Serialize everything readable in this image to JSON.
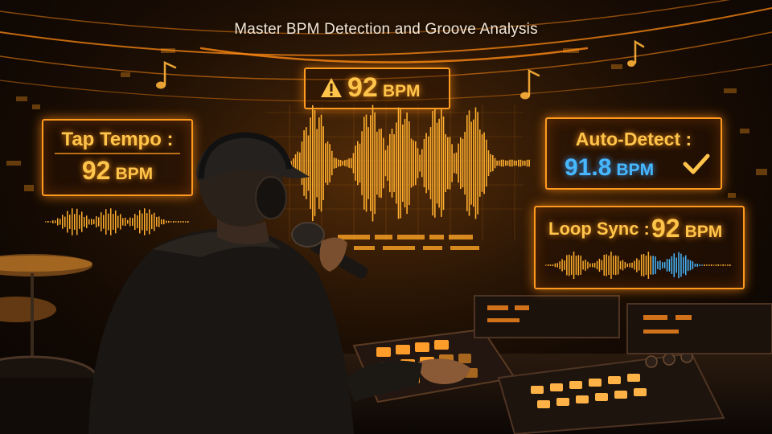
{
  "subtitle": "Master BPM Detection and Groove Analysis",
  "banner": {
    "value": "92",
    "unit": "BPM",
    "icon": "warning-icon"
  },
  "tap_tempo": {
    "label": "Tap Tempo :",
    "value": "92",
    "unit": "BPM"
  },
  "auto_detect": {
    "label": "Auto-Detect :",
    "value": "91.8",
    "unit": "BPM",
    "icon": "check-icon"
  },
  "loop_sync": {
    "label": "Loop Sync :",
    "value": "92",
    "unit": "BPM"
  },
  "colors": {
    "accent_orange": "#ff9a1e",
    "glow_yellow": "#ffc44a",
    "detect_blue": "#47b8ff",
    "background": "#1a0d04"
  }
}
